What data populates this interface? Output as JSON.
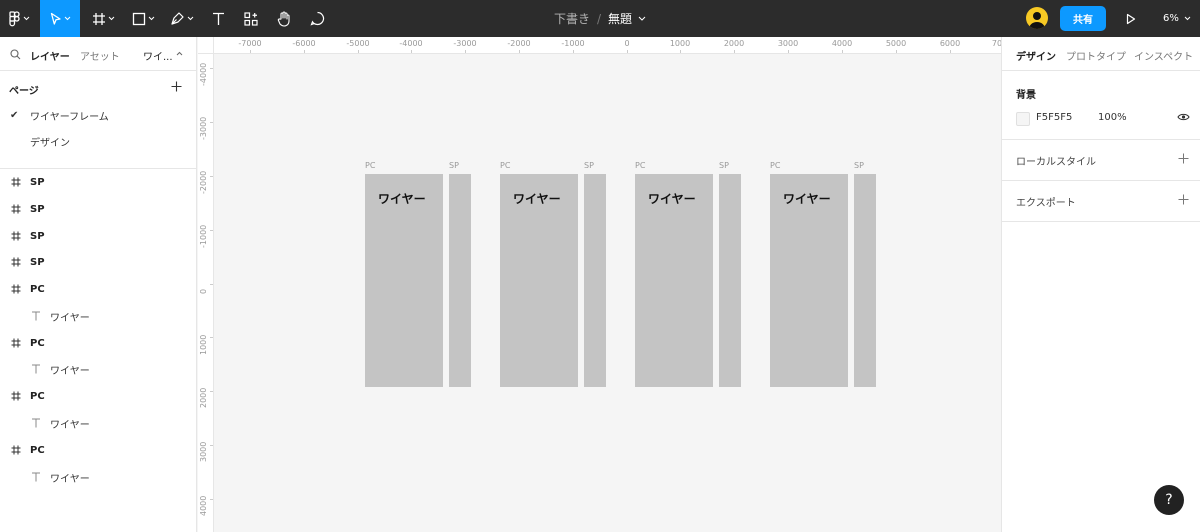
{
  "toolbar": {
    "breadcrumb_folder": "下書き",
    "breadcrumb_separator": "/",
    "file_name": "無題",
    "share_label": "共有",
    "zoom_level": "6%"
  },
  "left_panel": {
    "tabs": {
      "layers": "レイヤー",
      "assets": "アセット",
      "page_short": "ワイ..."
    },
    "pages_title": "ページ",
    "pages": [
      {
        "label": "ワイヤーフレーム",
        "active": true
      },
      {
        "label": "デザイン",
        "active": false
      }
    ],
    "layers": [
      {
        "type": "frame",
        "label": "SP"
      },
      {
        "type": "frame",
        "label": "SP"
      },
      {
        "type": "frame",
        "label": "SP"
      },
      {
        "type": "frame",
        "label": "SP"
      },
      {
        "type": "frame",
        "label": "PC"
      },
      {
        "type": "text",
        "label": "ワイヤー"
      },
      {
        "type": "frame",
        "label": "PC"
      },
      {
        "type": "text",
        "label": "ワイヤー"
      },
      {
        "type": "frame",
        "label": "PC"
      },
      {
        "type": "text",
        "label": "ワイヤー"
      },
      {
        "type": "frame",
        "label": "PC"
      },
      {
        "type": "text",
        "label": "ワイヤー"
      }
    ]
  },
  "rulers": {
    "x_labels": [
      "-7000",
      "-6000",
      "-5000",
      "-4000",
      "-3000",
      "-2000",
      "-1000",
      "0",
      "1000",
      "2000",
      "3000",
      "4000",
      "5000",
      "6000",
      "70"
    ],
    "y_labels": [
      "-4000",
      "-3000",
      "-2000",
      "-1000",
      "0",
      "1000",
      "2000",
      "3000",
      "4000"
    ]
  },
  "canvas": {
    "frames": [
      {
        "pc_label": "PC",
        "sp_label": "SP",
        "text": "ワイヤー"
      },
      {
        "pc_label": "PC",
        "sp_label": "SP",
        "text": "ワイヤー"
      },
      {
        "pc_label": "PC",
        "sp_label": "SP",
        "text": "ワイヤー"
      },
      {
        "pc_label": "PC",
        "sp_label": "SP",
        "text": "ワイヤー"
      }
    ],
    "background_color": "#F5F5F5",
    "frame_color": "#C4C4C4"
  },
  "right_panel": {
    "tabs": [
      "デザイン",
      "プロトタイプ",
      "インスペクト"
    ],
    "background_title": "背景",
    "background_hex": "F5F5F5",
    "background_opacity": "100%",
    "local_styles": "ローカルスタイル",
    "export": "エクスポート"
  },
  "help_label": "?",
  "colors": {
    "accent": "#0d99ff",
    "toolbar_bg": "#2c2c2c"
  },
  "icons": [
    "figma-menu-icon",
    "move-tool-icon",
    "frame-tool-icon",
    "shape-tool-icon",
    "pen-tool-icon",
    "text-tool-icon",
    "resources-icon",
    "hand-tool-icon",
    "comment-icon",
    "play-icon",
    "search-icon",
    "plus-icon",
    "eye-icon",
    "check-icon",
    "frame-hash-icon",
    "text-layer-icon"
  ]
}
